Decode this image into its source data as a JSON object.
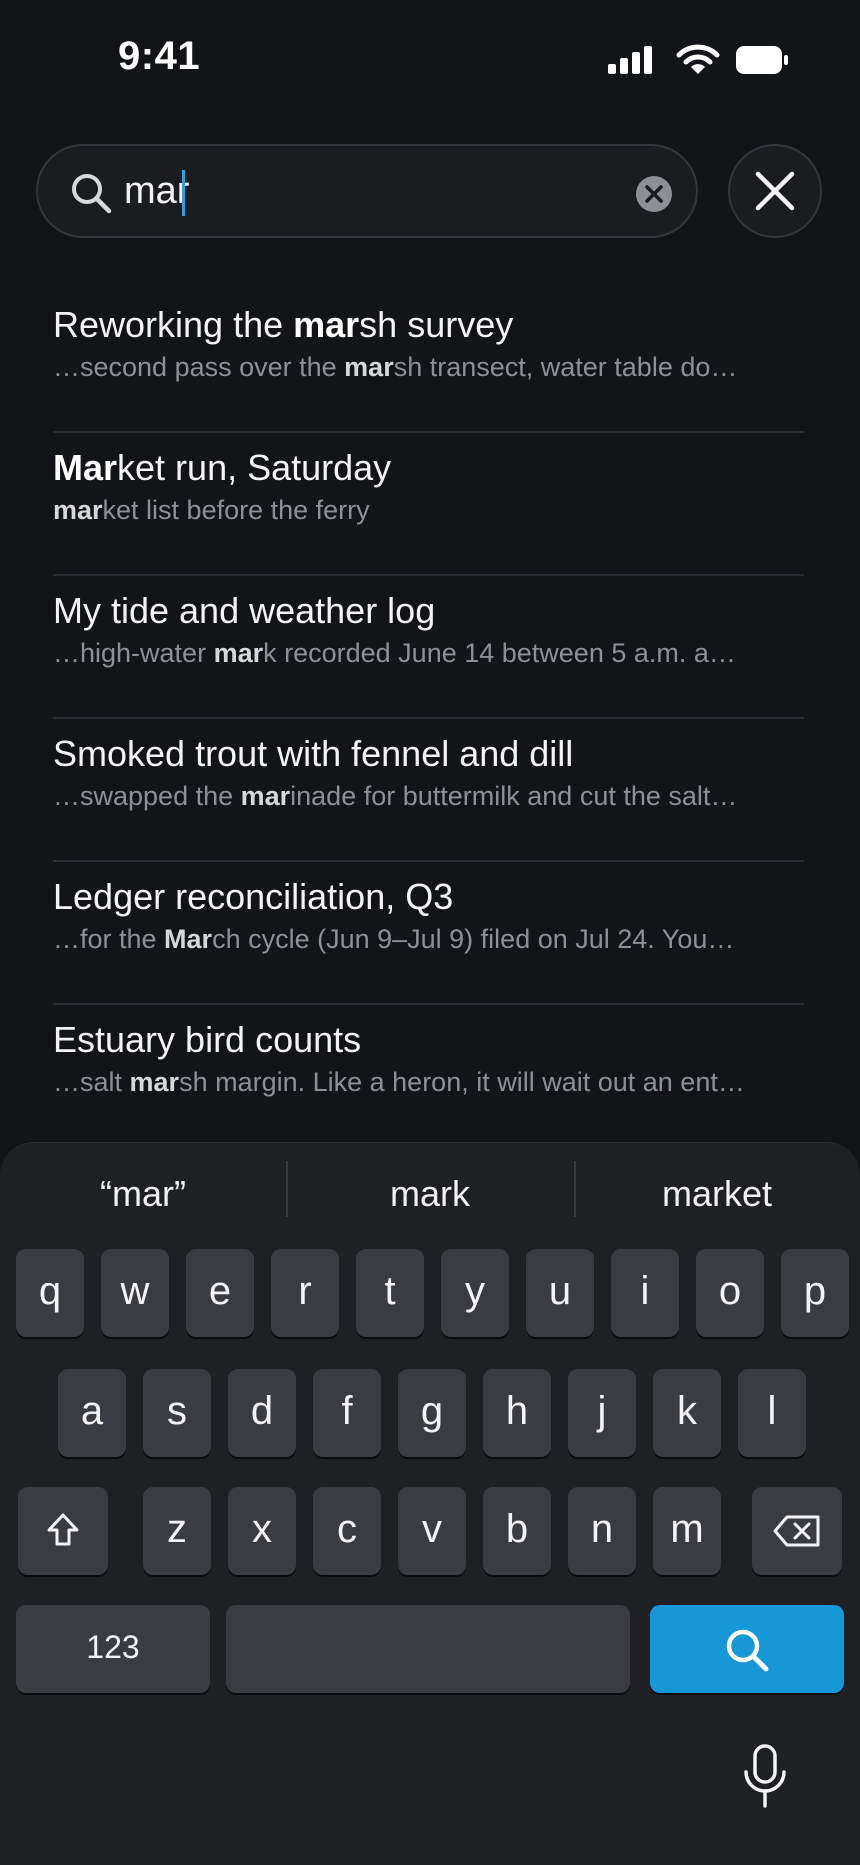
{
  "status_bar": {
    "time": "9:41",
    "icons": [
      "cellular-signal-icon",
      "wifi-icon",
      "battery-icon"
    ]
  },
  "search": {
    "query": "mar",
    "icons": [
      "search-icon",
      "clear-icon",
      "close-icon"
    ]
  },
  "results": [
    {
      "title_pre": "Reworking the ",
      "title_match": "mar",
      "title_post": "sh survey",
      "snippet_pre": "…second pass over the ",
      "snippet_match": "mar",
      "snippet_post": "sh transect, water table do…"
    },
    {
      "title_pre": "",
      "title_match": "Mar",
      "title_post": "ket run, Saturday",
      "snippet_pre": "",
      "snippet_match": "mar",
      "snippet_post": "ket list before the ferry"
    },
    {
      "title_pre": "My tide and weather log",
      "title_match": "",
      "title_post": "",
      "snippet_pre": "…high-water ",
      "snippet_match": "mar",
      "snippet_post": "k recorded June 14 between 5 a.m. a…"
    },
    {
      "title_pre": "Smoked trout with fennel and dill",
      "title_match": "",
      "title_post": "",
      "snippet_pre": "…swapped the ",
      "snippet_match": "mar",
      "snippet_post": "inade for buttermilk and cut the salt…"
    },
    {
      "title_pre": "Ledger reconciliation, Q3",
      "title_match": "",
      "title_post": "",
      "snippet_pre": "…for the ",
      "snippet_match": "Mar",
      "snippet_post": "ch cycle (Jun 9–Jul 9) filed on Jul 24. You…"
    },
    {
      "title_pre": "Estuary bird counts",
      "title_match": "",
      "title_post": "",
      "snippet_pre": "…salt ",
      "snippet_match": "mar",
      "snippet_post": "sh margin. Like a heron, it will wait out an ent…"
    }
  ],
  "keyboard": {
    "suggestions": [
      "“mar”",
      "mark",
      "market"
    ],
    "row1": [
      "q",
      "w",
      "e",
      "r",
      "t",
      "y",
      "u",
      "i",
      "o",
      "p"
    ],
    "row2": [
      "a",
      "s",
      "d",
      "f",
      "g",
      "h",
      "j",
      "k",
      "l"
    ],
    "row3": [
      "z",
      "x",
      "c",
      "v",
      "b",
      "n",
      "m"
    ],
    "numbers_label": "123",
    "icons": [
      "shift-icon",
      "backspace-icon",
      "search-key-icon",
      "microphone-icon"
    ],
    "accent_color": "#1597d8"
  }
}
